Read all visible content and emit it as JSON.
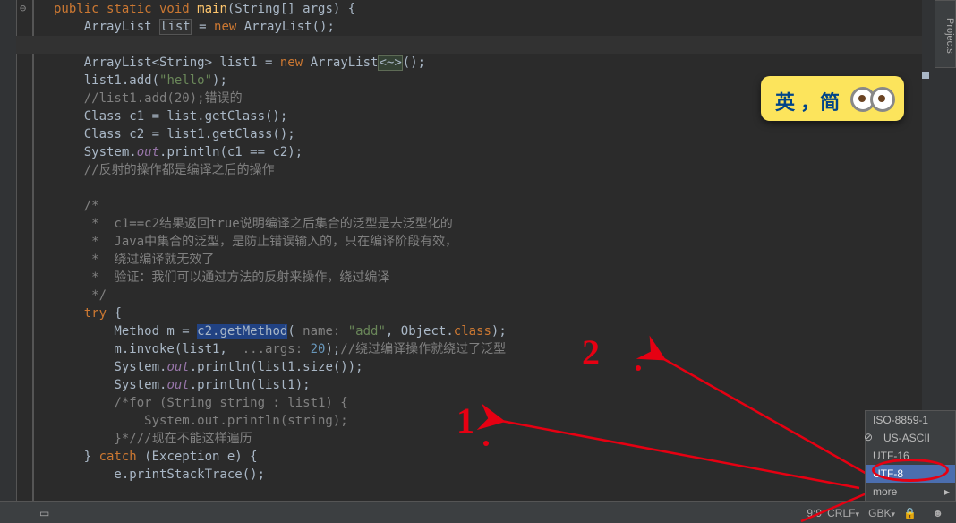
{
  "side_tab": "Projects",
  "ime": {
    "text": "英 ，简"
  },
  "code": {
    "l1": {
      "pre": "public static void ",
      "mth": "main",
      "pre2": "(String[] args) {"
    },
    "l2": {
      "pre": "    ArrayList ",
      "boxed": "list",
      "pre2": " = ",
      "kw": "new",
      "pre3": " ArrayList();"
    },
    "l3": "",
    "l4": {
      "pre": "    ArrayList<String> list1 = ",
      "kw": "new",
      "pre2": " ArrayList",
      "boxed": "<~>",
      "pre3": "();"
    },
    "l5": {
      "pre": "    list1.add(",
      "str": "\"hello\"",
      "pre2": ");"
    },
    "l6": {
      "cm": "    //list1.add(20);错误的"
    },
    "l7": {
      "pre": "    Class c1 = list.getClass();"
    },
    "l8": {
      "pre": "    Class c2 = list1.getClass();"
    },
    "l9": {
      "pre": "    System.",
      "fld": "out",
      "pre2": ".println(c1 == c2);"
    },
    "l10": {
      "cm": "    //反射的操作都是编译之后的操作"
    },
    "l11": "",
    "l12": {
      "cm": "    /*"
    },
    "l13": {
      "cm": "     *  c1==c2结果返回true说明编译之后集合的泛型是去泛型化的"
    },
    "l14": {
      "cm": "     *  Java中集合的泛型，是防止错误输入的，只在编译阶段有效，"
    },
    "l15": {
      "cm": "     *  绕过编译就无效了"
    },
    "l16": {
      "cm": "     *  验证：我们可以通过方法的反射来操作，绕过编译"
    },
    "l17": {
      "cm": "     */"
    },
    "l18": {
      "kw": "    try",
      "pre": " {"
    },
    "l19": {
      "pre": "        Method m = ",
      "sel": "c2.getMethod",
      "pre2": "( ",
      "pn": "name: ",
      "str": "\"add\"",
      "pre3": ", Object.",
      "kw2": "class",
      "pre4": ");"
    },
    "l20": {
      "pre": "        m.invoke(list1,  ",
      "pn": "...args: ",
      "num": "20",
      "pre2": ");",
      "cm": "//绕过编译操作就绕过了泛型"
    },
    "l21": {
      "pre": "        System.",
      "fld": "out",
      "pre2": ".println(list1.size());"
    },
    "l22": {
      "pre": "        System.",
      "fld": "out",
      "pre2": ".println(list1);"
    },
    "l23": {
      "cm": "        /*for (String string : list1) {"
    },
    "l24": {
      "cm": "            System.out.println(string);"
    },
    "l25": {
      "cm1": "        }*/",
      "cm2": "//现在不能这样遍历"
    },
    "l26": {
      "pre": "    } ",
      "kw": "catch",
      "pre2": " (Exception e) {"
    },
    "l27": {
      "pre": "        e.printStackTrace();"
    }
  },
  "encoding_menu": {
    "items": [
      "ISO-8859-1",
      "US-ASCII",
      "UTF-16",
      "UTF-8",
      "more"
    ],
    "selected": "UTF-8"
  },
  "statusbar": {
    "pos": "9:9",
    "lineend": "CRLF",
    "enc": "GBK",
    "ins": ""
  },
  "annotations": {
    "num1": "1",
    "num2": "2"
  }
}
